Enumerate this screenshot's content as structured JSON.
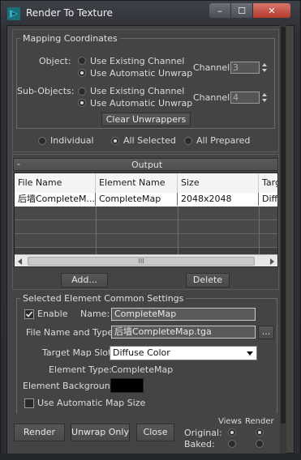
{
  "window": {
    "title": "Render To Texture",
    "minimize": "–",
    "maximize": "☐",
    "close": "✕"
  },
  "mapping": {
    "title": "Mapping Coordinates",
    "object_label": "Object:",
    "object_option1": "Use Existing Channel",
    "object_option2": "Use Automatic Unwrap",
    "object_selected": "Use Automatic Unwrap",
    "channel_label": "Channel:",
    "object_channel": "3",
    "subobjects_label": "Sub-Objects:",
    "sub_option1": "Use Existing Channel",
    "sub_option2": "Use Automatic Unwrap",
    "sub_selected": "Use Automatic Unwrap",
    "sub_channel": "4",
    "clear_button": "Clear Unwrappers"
  },
  "selection": {
    "options": [
      "Individual",
      "All Selected",
      "All Prepared"
    ],
    "selected": "All Selected"
  },
  "output": {
    "rollout_minus": "-",
    "title": "Output",
    "columns": [
      "File Name",
      "Element Name",
      "Size",
      "Targ"
    ],
    "row": {
      "file": "后墙CompleteM...",
      "element": "CompleteMap",
      "size": "2048x2048",
      "target": "Diffu"
    },
    "add_button": "Add...",
    "delete_button": "Delete",
    "hscroll_grip": "III"
  },
  "element_settings": {
    "title": "Selected Element Common Settings",
    "enable_label": "Enable",
    "enable_checked": true,
    "name_label": "Name:",
    "name_value": "CompleteMap",
    "filename_label": "File Name and Type:",
    "filename_value": "后墙CompleteMap.tga",
    "browse_button": "...",
    "target_slot_label": "Target Map Slot:",
    "target_slot_value": "Diffuse Color",
    "element_type_label": "Element Type:",
    "element_type_value": "CompleteMap",
    "background_label": "Element Background:",
    "background_color": "#000000",
    "auto_size_label": "Use Automatic Map Size",
    "auto_size_checked": false
  },
  "bottom": {
    "render_button": "Render",
    "unwrap_button": "Unwrap Only",
    "close_button": "Close",
    "views_label": "Views",
    "render_label": "Render",
    "original_label": "Original:",
    "baked_label": "Baked:"
  },
  "colors": {
    "panel": "#444444",
    "title_close": "#c9483a",
    "accent_icon": "#2fb1c4"
  }
}
